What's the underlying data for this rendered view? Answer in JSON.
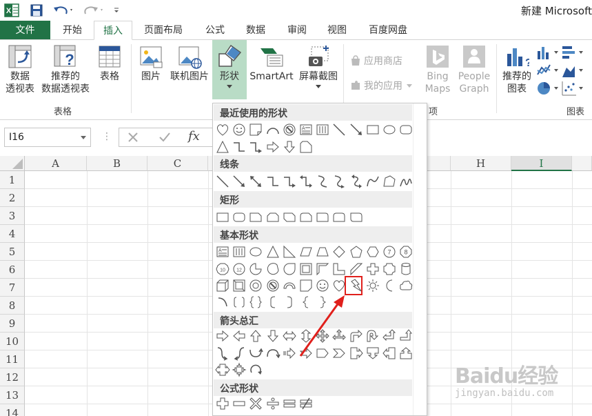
{
  "titlebar": {
    "title": "新建 Microsoft"
  },
  "tabs": [
    {
      "label": "文件"
    },
    {
      "label": "开始"
    },
    {
      "label": "插入"
    },
    {
      "label": "页面布局"
    },
    {
      "label": "公式"
    },
    {
      "label": "数据"
    },
    {
      "label": "审阅"
    },
    {
      "label": "视图"
    },
    {
      "label": "百度网盘"
    }
  ],
  "ribbon": {
    "pivot_line1": "数据",
    "pivot_line2": "透视表",
    "rec_pivot_line1": "推荐的",
    "rec_pivot_line2": "数据透视表",
    "table": "表格",
    "group_tables": "表格",
    "picture": "图片",
    "online_picture": "联机图片",
    "shapes": "形状",
    "smartart": "SmartArt",
    "screenshot": "屏幕截图",
    "app_store": "应用商店",
    "my_apps": "我的应用",
    "bing_line1": "Bing",
    "bing_line2": "Maps",
    "people_line1": "People",
    "people_line2": "Graph",
    "group_apps_tail": "项",
    "rec_chart_line1": "推荐的",
    "rec_chart_line2": "图表",
    "group_charts": "图表"
  },
  "formula": {
    "name_box": "I16",
    "fx": "fx"
  },
  "grid": {
    "columns": [
      "A",
      "B",
      "C",
      "H",
      "I"
    ],
    "rows": [
      "1",
      "2",
      "3",
      "4",
      "5",
      "6",
      "7",
      "8",
      "9",
      "10",
      "11",
      "12",
      "13",
      "14"
    ]
  },
  "dropdown": {
    "sections": [
      "最近使用的形状",
      "线条",
      "矩形",
      "基本形状",
      "箭头总汇",
      "公式形状"
    ],
    "badges": [
      "7",
      "8",
      "10",
      "12"
    ]
  },
  "watermark": {
    "brand": "Baidu经验",
    "url": "jingyan.baidu.com"
  },
  "colors": {
    "excel_green": "#217346",
    "highlight_red": "#e0201c",
    "active_column": "#217346"
  }
}
